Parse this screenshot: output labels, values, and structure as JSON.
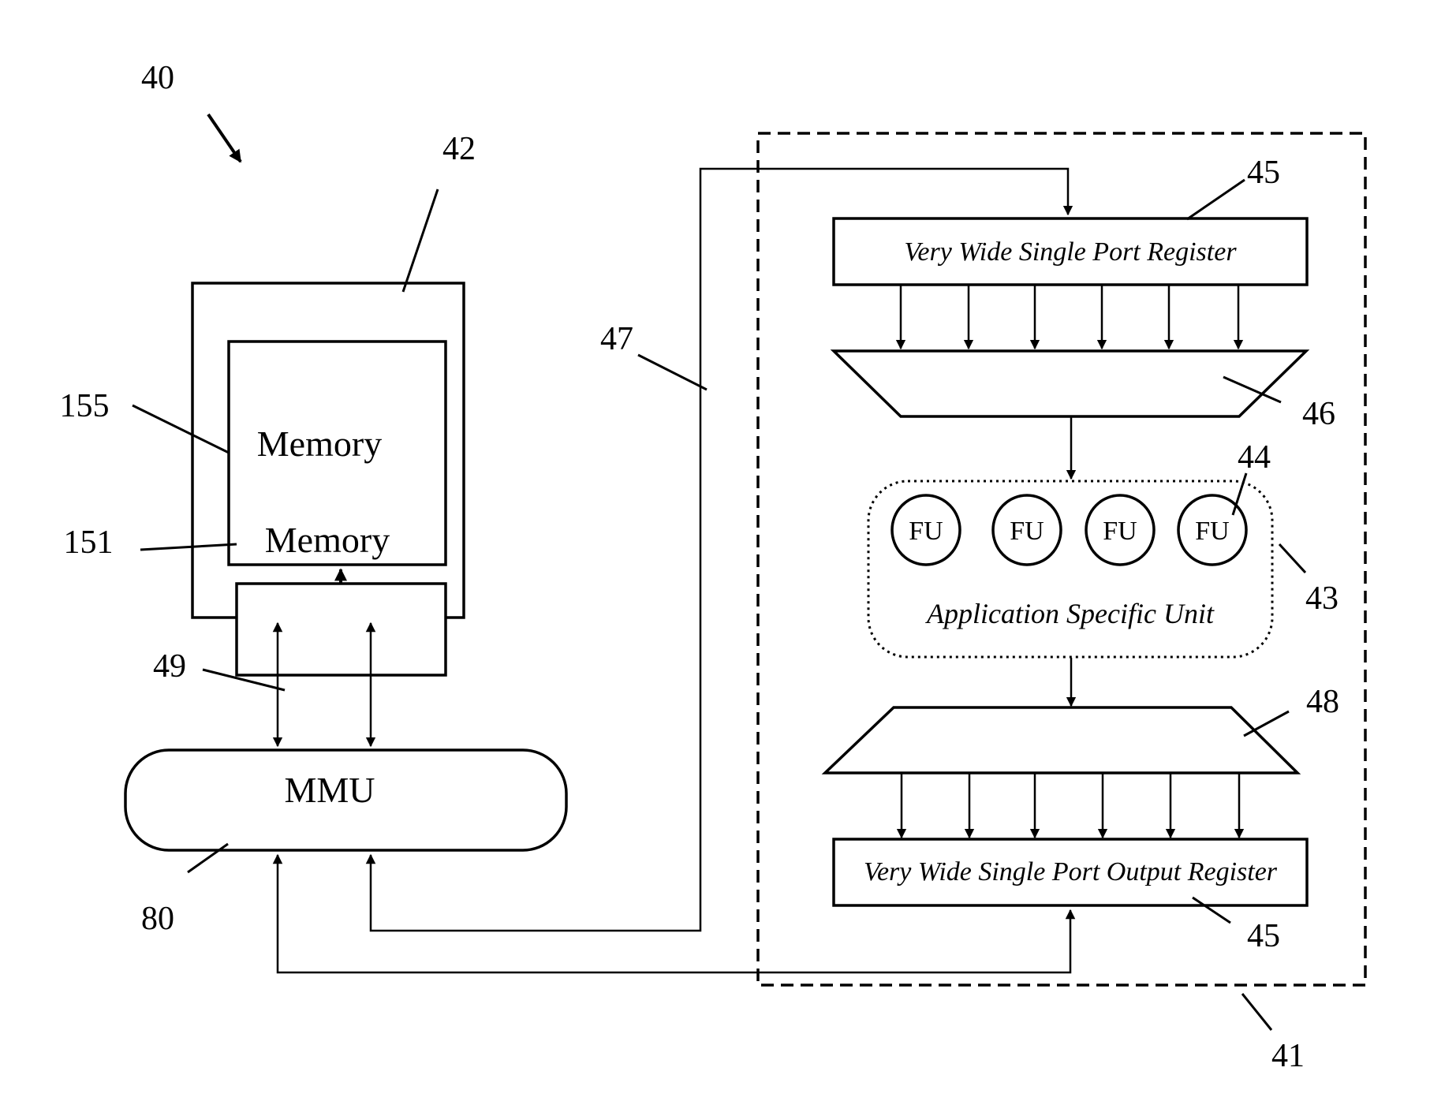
{
  "figure": {
    "reference_numerals": {
      "system": "40",
      "memory_subsystem": "42",
      "memory_large": "155",
      "memory_small": "151",
      "bus": "49",
      "mmu": "80",
      "connection": "47",
      "processor": "41",
      "input_register": "45",
      "output_register": "45",
      "input_mux": "46",
      "functional_unit": "44",
      "application_specific_unit": "43",
      "output_mux": "48"
    },
    "blocks": {
      "memory_large_label": "Memory",
      "memory_small_label": "Memory",
      "mmu_label": "MMU",
      "input_register_label": "Very Wide Single Port Register",
      "output_register_label": "Very Wide Single Port Output Register",
      "asu_label": "Application Specific Unit",
      "functional_units": [
        "FU",
        "FU",
        "FU",
        "FU"
      ]
    }
  }
}
